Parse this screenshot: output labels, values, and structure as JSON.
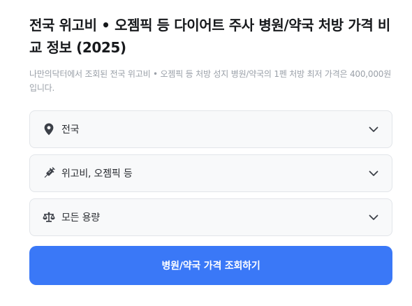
{
  "header": {
    "title": "전국 위고비 • 오젬픽 등 다이어트 주사 병원/약국 처방 가격 비교 정보 (2025)",
    "subtitle": "나만의닥터에서 조회된 전국 위고비 • 오젬픽 등 처방 성지 병원/약국의 1펜 처방 최저 가격은 400,000원 입니다."
  },
  "filters": {
    "region": {
      "value": "전국",
      "icon": "location-pin-icon"
    },
    "drug": {
      "value": "위고비, 오젬픽 등",
      "icon": "syringe-icon"
    },
    "dosage": {
      "value": "모든 용량",
      "icon": "scale-icon"
    }
  },
  "cta": {
    "label": "병원/약국 가격 조회하기"
  },
  "colors": {
    "accent": "#3a78f7",
    "field_bg": "#f8f9fa",
    "field_border": "#e2e5e9",
    "muted_text": "#9aa0a8"
  }
}
